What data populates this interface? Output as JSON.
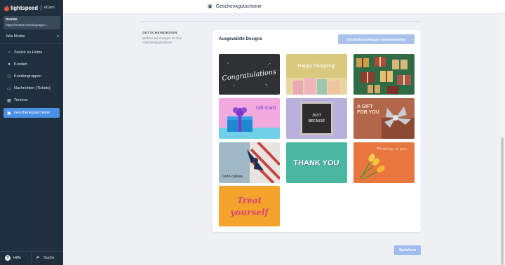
{
  "brand": {
    "name": "lightspeed",
    "product": "eCom"
  },
  "shop": {
    "name": "trustee",
    "url": "https://trustee.webshopapp.c..."
  },
  "user": {
    "name": "Julia Meister"
  },
  "nav": {
    "items": [
      {
        "label": "Zurück zu Home",
        "icon": "chevron-left-icon"
      },
      {
        "label": "Kunden",
        "icon": "user-icon"
      },
      {
        "label": "Kundengruppen",
        "icon": "users-icon"
      },
      {
        "label": "Nachrichten (Tickets)",
        "icon": "chat-icon"
      },
      {
        "label": "Termine",
        "icon": "calendar-icon"
      },
      {
        "label": "Geschenkgutscheine",
        "icon": "gift-icon",
        "active": true
      }
    ]
  },
  "footer": {
    "help_label": "Hilfe",
    "search_label": "Suche"
  },
  "topbar": {
    "title": "Geschenkgutscheine",
    "icon": "gift-icon"
  },
  "section": {
    "title": "GUTSCHEINDESIGN",
    "description": "Wählen Sie Designs für Ihre Geschenkgutscheine."
  },
  "designs": {
    "title": "Ausgewählte Designs",
    "reset_label": "Standardeinstellungen wiederherstellen",
    "tiles": [
      {
        "name": "congratulations",
        "text": "Congratulations"
      },
      {
        "name": "happy-shopping",
        "text": "Happy Shopping!"
      },
      {
        "name": "gift-boxes-green",
        "text": ""
      },
      {
        "name": "gift-card-blue-box",
        "text": "Gift Card"
      },
      {
        "name": "just-because",
        "text_line1": "JUST",
        "text_line2": "BECAUSE"
      },
      {
        "name": "a-gift-for-you",
        "text_line1": "A GIFT",
        "text_line2": "FOR YOU"
      },
      {
        "name": "carte-cadeau",
        "text": "Carte-cadeau"
      },
      {
        "name": "thank-you",
        "text": "THANK YOU"
      },
      {
        "name": "thinking-of-you",
        "text": "Thinking of you.."
      },
      {
        "name": "treat-yourself",
        "text_line1": "Treat",
        "text_line2": "yourself"
      }
    ]
  },
  "save_label": "Speichern",
  "colors": {
    "sidebar": "#1f2f3e",
    "accent": "#4a90e2",
    "button_disabled": "#a8c2ec"
  }
}
